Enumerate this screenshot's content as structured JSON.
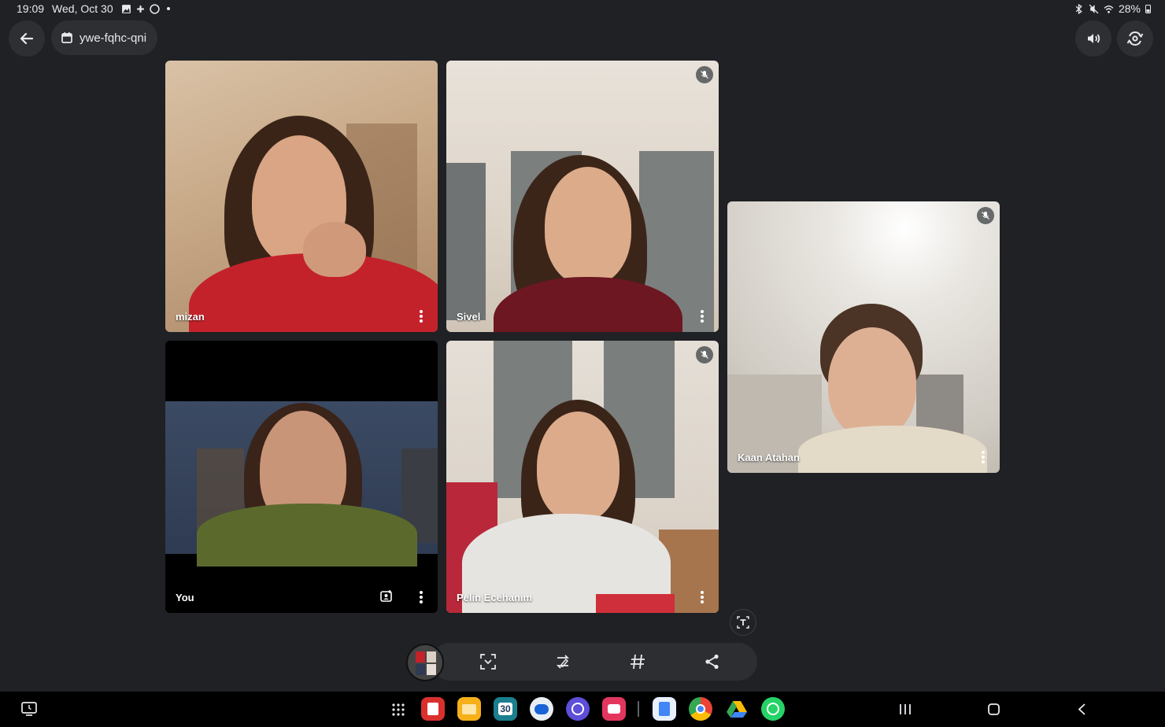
{
  "status": {
    "time": "19:09",
    "date": "Wed, Oct 30",
    "battery": "28%"
  },
  "meeting": {
    "code": "ywe-fqhc-qni"
  },
  "participants": [
    {
      "name": "mizan"
    },
    {
      "name": "Sivel"
    },
    {
      "name": "You"
    },
    {
      "name": "Pelin Ecehanım"
    },
    {
      "name": "Kaan Atahan"
    }
  ],
  "icons": {
    "back": "back-arrow-icon",
    "calendar": "calendar-icon",
    "audio": "speaker-icon",
    "switch_camera": "switch-camera-icon",
    "mic_off": "mic-off-icon",
    "more": "more-vertical-icon",
    "reactions": "reaction-icon"
  },
  "capture_toolbar": [
    "scan-icon",
    "edit-icon",
    "hashtag-icon",
    "share-icon"
  ],
  "taskbar_apps": [
    "apps-grid-icon",
    "app-red",
    "app-folder",
    "calendar-30",
    "messages",
    "internet",
    "camera-app",
    "docs",
    "chrome",
    "drive",
    "whatsapp"
  ],
  "colors": {
    "background": "#1f2124",
    "active_outline": "#3b5ea8",
    "control": "#2d2f33"
  }
}
